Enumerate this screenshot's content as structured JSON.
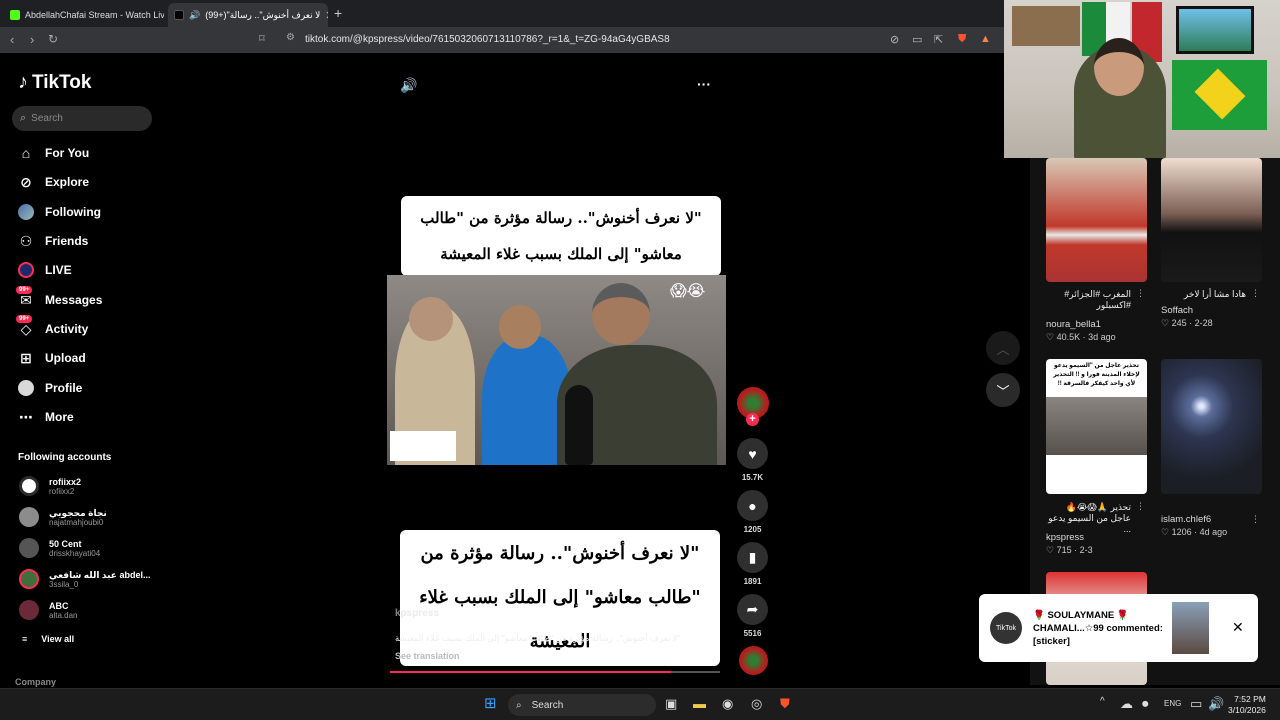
{
  "browser": {
    "tabs": [
      {
        "title": "AbdellahChafai Stream - Watch Live"
      },
      {
        "title": "(99+)\"لا نعرف أخنوش\".. رسالة"
      }
    ],
    "url": "tiktok.com/@kpspress/video/7615032060713110786?_r=1&_t=ZG-94aG4yGBAS8",
    "icons": {
      "back": "arrow-left-icon",
      "forward": "arrow-right-icon",
      "reload": "reload-icon",
      "bookmark": "bookmark-icon"
    }
  },
  "sidebar": {
    "brand": "TikTok",
    "search_placeholder": "Search",
    "menu": [
      {
        "label": "For You",
        "icon": "home-icon"
      },
      {
        "label": "Explore",
        "icon": "compass-icon"
      },
      {
        "label": "Following",
        "icon": "following-icon"
      },
      {
        "label": "Friends",
        "icon": "friends-icon"
      },
      {
        "label": "LIVE",
        "icon": "live-icon"
      },
      {
        "label": "Messages",
        "icon": "messages-icon",
        "badge": "99+"
      },
      {
        "label": "Activity",
        "icon": "activity-icon",
        "badge": "99+"
      },
      {
        "label": "Upload",
        "icon": "upload-icon"
      },
      {
        "label": "Profile",
        "icon": "profile-icon"
      },
      {
        "label": "More",
        "icon": "more-icon"
      }
    ],
    "following_title": "Following accounts",
    "accounts": [
      {
        "name": "rofiixx2",
        "handle": "rofiixx2"
      },
      {
        "name": "نجاة محجوبي",
        "handle": "najatmahjoubi0"
      },
      {
        "name": "50 Cent",
        "handle": "drisskhayati04"
      },
      {
        "name": "عبد الله شافعي abdel...",
        "handle": "3ssila_0"
      },
      {
        "name": "ABC",
        "handle": "alta.dan"
      }
    ],
    "view_all": "View all",
    "company": "Company"
  },
  "video": {
    "caption_top": "\"لا نعرف أخنوش\".. رسالة مؤثرة من \"طالب معاشو\" إلى الملك بسبب غلاء المعيشة",
    "caption_bottom": "\"لا نعرف أخنوش\".. رسالة مؤثرة من \"طالب معاشو\" إلى الملك بسبب غلاء المعيشة",
    "emoji_top": "😱😭",
    "emoji_bottom": "😭😱😨",
    "author": "kpspress",
    "description": "\"لا نعرف أخنوش\".. رسالة مؤثرة من \"طالب معاشو\" إلى الملك بسبب غلاء المعيشة",
    "see_translation": "See translation",
    "progress": 0.85,
    "likes": "15.7K",
    "comments": "1205",
    "saves": "1891",
    "shares": "5516"
  },
  "right_panel": {
    "items": [
      {
        "desc": "المغرب #الجزائر# #اكسبلور",
        "user": "noura_bella1",
        "likes": "40.5K",
        "date": "3d ago"
      },
      {
        "desc": "هادا مشا أرا لاخر",
        "user": "Soffach",
        "likes": "245",
        "date": "2-28"
      },
      {
        "desc": "تحذير 🙏😱😭🔥 عاجل من السيمو يدعو ...",
        "user": "kpspress",
        "likes": "715",
        "date": "2-3"
      },
      {
        "desc": "",
        "user": "islam.chlef6",
        "likes": "1206",
        "date": "4d ago"
      }
    ],
    "thumb_caption": "تحذير عاجل من \"السيمو يدعو لإخلاء المدينة فورا و !! التحذير لأي واحد كيفكر فالسرقة !!"
  },
  "notification": {
    "logo_text": "TikTok",
    "text": "🌹 SOULAYMANE 🌹 CHAMALI...☆99 commented: [sticker]"
  },
  "taskbar": {
    "search": "Search",
    "lang": "ENG",
    "time": "7:52 PM",
    "date": "3/10/2026"
  }
}
